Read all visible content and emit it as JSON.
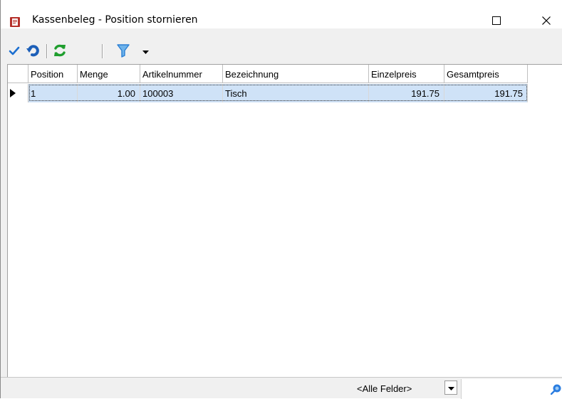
{
  "window": {
    "title": "Kassenbeleg - Position stornieren",
    "icons": {
      "app": "receipt-icon",
      "maximize": "maximize-icon",
      "close": "close-icon"
    }
  },
  "toolbar": {
    "icons": [
      "checkmark-icon",
      "undo-icon",
      "refresh-icon",
      "filter-icon",
      "dropdown-arrow-icon"
    ],
    "colors": {
      "check": "#1c6fd0",
      "undo": "#1c5fb8",
      "refresh": "#1f9e2e",
      "filter": "#2a7fd4"
    }
  },
  "grid": {
    "columns": [
      "Position",
      "Menge",
      "Artikelnummer",
      "Bezeichnung",
      "Einzelpreis",
      "Gesamtpreis"
    ],
    "rows": [
      {
        "position": "1",
        "menge": "1.00",
        "artikelnummer": "100003",
        "bezeichnung": "Tisch",
        "einzelpreis": "191.75",
        "gesamtpreis": "191.75"
      }
    ],
    "selected_row_color": "#cfe2f7"
  },
  "statusbar": {
    "field_select": "<Alle Felder>",
    "search_value": ""
  }
}
